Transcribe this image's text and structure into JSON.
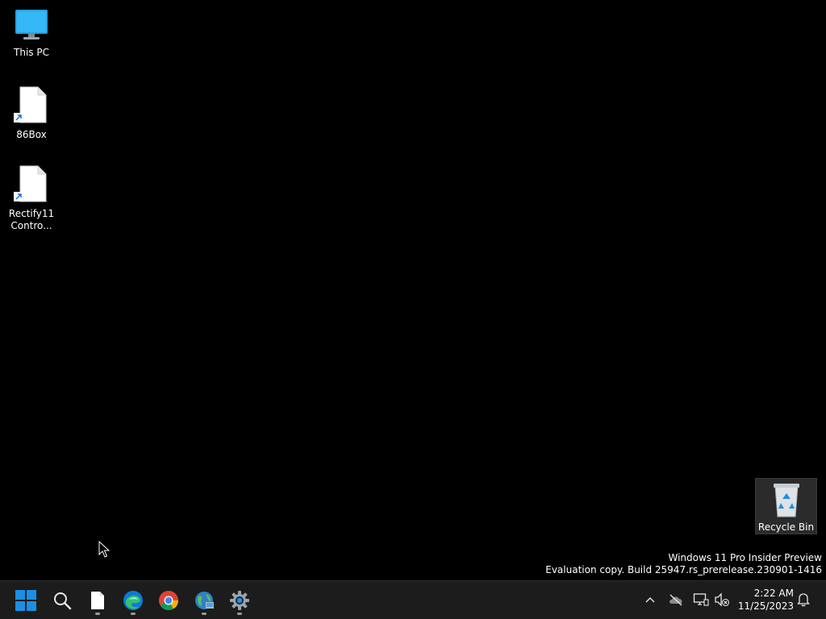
{
  "desktop": {
    "icons": [
      {
        "label": "This PC",
        "icon": "monitor-icon"
      },
      {
        "label": "86Box",
        "icon": "file-shortcut-icon"
      },
      {
        "label": "Rectify11\nContro...",
        "icon": "file-shortcut-icon"
      }
    ],
    "recycle_bin": {
      "label": "Recycle Bin",
      "icon": "recycle-bin-icon"
    },
    "watermark": {
      "line1": "Windows 11 Pro Insider Preview",
      "line2": "Evaluation copy. Build 25947.rs_prerelease.230901-1416"
    }
  },
  "taskbar": {
    "buttons": [
      {
        "name": "start",
        "icon": "windows-logo-icon"
      },
      {
        "name": "search",
        "icon": "search-icon"
      },
      {
        "name": "file",
        "icon": "file-icon",
        "running": true
      },
      {
        "name": "edge",
        "icon": "edge-icon",
        "running": true
      },
      {
        "name": "chrome",
        "icon": "chrome-icon"
      },
      {
        "name": "browser",
        "icon": "globe-icon",
        "running": true
      },
      {
        "name": "settings",
        "icon": "gear-icon",
        "running": true
      }
    ],
    "tray": {
      "icons": [
        "chevron-up-icon",
        "cloud-offline-icon",
        "network-icon",
        "volume-muted-icon",
        "notification-bell-icon"
      ],
      "time": "2:22 AM",
      "date": "11/25/2023"
    }
  },
  "colors": {
    "desktop_bg": "#000000",
    "taskbar_bg": "#1c1c1c",
    "windows_blue": "#1a8fe3"
  }
}
